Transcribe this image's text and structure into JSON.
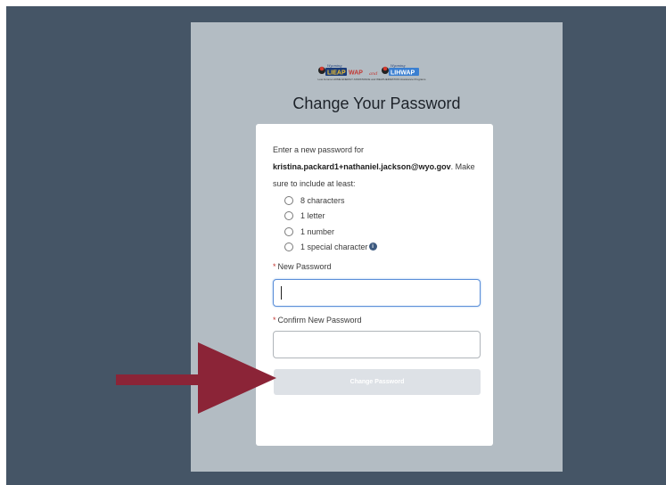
{
  "logo": {
    "left_text": "LIEAP",
    "left_top_text": "Wyoming",
    "middle_text": "WAP",
    "conjunction": "and",
    "right_text": "LIHWAP",
    "right_top_text": "Wyoming",
    "tagline": "Low Income HOME ENERGY ASSISTANCE and WEATHERIZATION Assistance Programs"
  },
  "page": {
    "title": "Change Your Password"
  },
  "instructions": {
    "prefix": "Enter a new password for",
    "email": "kristina.packard1+nathaniel.jackson@wyo.gov",
    "suffix": ". Make sure to include at least:"
  },
  "requirements": [
    "8 characters",
    "1 letter",
    "1 number",
    "1 special character"
  ],
  "form": {
    "new_password_label": "New Password",
    "new_password_value": "",
    "confirm_password_label": "Confirm New Password",
    "confirm_password_value": "",
    "required_marker": "*",
    "submit_label": "Change Password"
  },
  "colors": {
    "background": "#455566",
    "panel": "#b3bcc3",
    "arrow": "#8b2437",
    "required": "#c23934",
    "button_disabled": "#dde1e6",
    "focus_border": "#5b8fd8"
  }
}
